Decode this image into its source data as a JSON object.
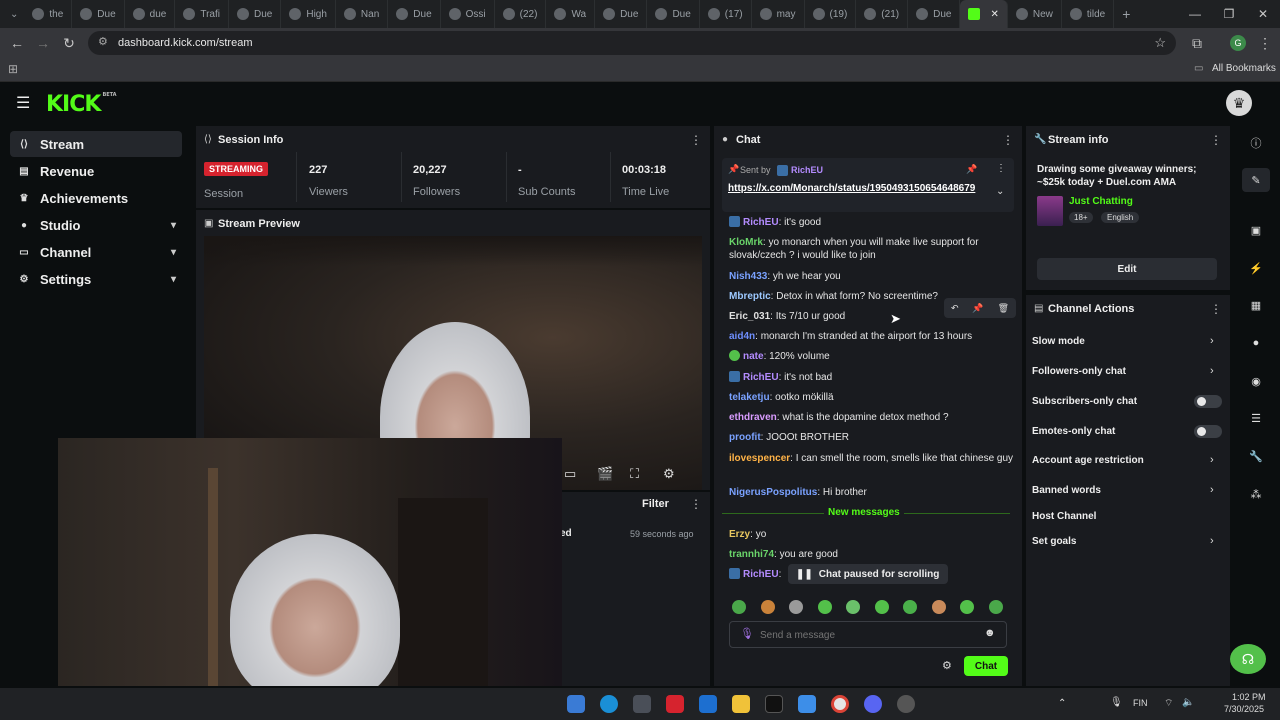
{
  "browser": {
    "tabs": [
      "the",
      "Due",
      "due",
      "Trafi",
      "Due",
      "High",
      "Nan",
      "Due",
      "Ossi",
      "(22)",
      "Wa",
      "Due",
      "Due",
      "(17)",
      "may",
      "(19)",
      "(21)",
      "Due",
      "",
      "New",
      "tilde"
    ],
    "url": "dashboard.kick.com/stream",
    "bookmarks_label": "All Bookmarks",
    "profile_initial": "G"
  },
  "brand": {
    "logo": "KICK",
    "beta": "BETA"
  },
  "sidebar": {
    "items": [
      {
        "label": "Stream",
        "icon": "stream-icon",
        "expandable": false
      },
      {
        "label": "Revenue",
        "icon": "revenue-icon",
        "expandable": false
      },
      {
        "label": "Achievements",
        "icon": "trophy-icon",
        "expandable": false
      },
      {
        "label": "Studio",
        "icon": "studio-icon",
        "expandable": true
      },
      {
        "label": "Channel",
        "icon": "channel-icon",
        "expandable": true
      },
      {
        "label": "Settings",
        "icon": "gear-icon",
        "expandable": true
      }
    ]
  },
  "session": {
    "title": "Session Info",
    "status": "STREAMING",
    "status_label": "Session",
    "stats": [
      {
        "value": "227",
        "label": "Viewers"
      },
      {
        "value": "20,227",
        "label": "Followers"
      },
      {
        "value": "-",
        "label": "Sub Counts"
      },
      {
        "value": "00:03:18",
        "label": "Time Live"
      }
    ]
  },
  "preview": {
    "title": "Stream Preview"
  },
  "activity": {
    "filter_label": "Filter",
    "partial_label": "ed",
    "time": "59 seconds ago"
  },
  "chat": {
    "title": "Chat",
    "pinned": {
      "sent_by_label": "Sent by",
      "sender": "RichEU",
      "link": "https://x.com/Monarch/status/1950493150654648679"
    },
    "messages": [
      {
        "user": "RichEU",
        "text": "it's good",
        "color": "#b48cff",
        "badge": "blue"
      },
      {
        "user": "KloMrk",
        "text": "yo monarch when you will make live support for slovak/czech ? i would like to join",
        "color": "#6ad46a",
        "badge": ""
      },
      {
        "user": "Nish433",
        "text": "yh we hear you",
        "color": "#7aa2ff",
        "badge": ""
      },
      {
        "user": "Mbreptic",
        "text": "Detox in what form? No screentime?",
        "color": "#9dc9ff",
        "badge": ""
      },
      {
        "user": "Eric_031",
        "text": "Its 7/10 ur good",
        "color": "#e0e0e0",
        "badge": ""
      },
      {
        "user": "aid4n",
        "text": "monarch I'm stranded at the airport for 13 hours",
        "color": "#6f8fff",
        "badge": ""
      },
      {
        "user": "nate",
        "text": "120% volume",
        "color": "#b48cff",
        "badge": "green"
      },
      {
        "user": "RichEU",
        "text": "it's not bad",
        "color": "#b48cff",
        "badge": "blue"
      },
      {
        "user": "telaketju",
        "text": "ootko mökillä",
        "color": "#7aa2ff",
        "badge": ""
      },
      {
        "user": "ethdraven",
        "text": "what is the dopamine detox method ?",
        "color": "#d99cff",
        "badge": ""
      },
      {
        "user": "proofit",
        "text": "JOOOt BROTHER",
        "color": "#7aa2ff",
        "badge": ""
      },
      {
        "user": "ilovespencer",
        "text": "I can smell the room, smells like that chinese guy",
        "color": "#ffb347",
        "badge": ""
      },
      {
        "user": "NigerusPospolitus",
        "text": "Hi brother",
        "color": "#7aa2ff",
        "badge": ""
      }
    ],
    "new_messages_label": "New messages",
    "new_messages": [
      {
        "user": "Erzy",
        "text": "yo",
        "color": "#e8c760",
        "badge": ""
      },
      {
        "user": "trannhi74",
        "text": "you are good",
        "color": "#6ad46a",
        "badge": ""
      },
      {
        "user": "RichEU",
        "text": "",
        "color": "#b48cff",
        "badge": "blue"
      }
    ],
    "paused_label": "Chat paused for scrolling",
    "input_placeholder": "Send a message",
    "send_label": "Chat"
  },
  "stream_info": {
    "title": "Stream info",
    "stream_title": "Drawing some giveaway winners; ~$25k today + Duel.com AMA",
    "category": "Just Chatting",
    "tags": [
      "18+",
      "English"
    ],
    "edit_label": "Edit"
  },
  "channel_actions": {
    "title": "Channel Actions",
    "items": [
      {
        "label": "Slow mode",
        "control": "chevron"
      },
      {
        "label": "Followers-only chat",
        "control": "chevron"
      },
      {
        "label": "Subscribers-only chat",
        "control": "toggle"
      },
      {
        "label": "Emotes-only chat",
        "control": "toggle"
      },
      {
        "label": "Account age restriction",
        "control": "chevron"
      },
      {
        "label": "Banned words",
        "control": "chevron"
      },
      {
        "label": "Host Channel",
        "control": "none"
      },
      {
        "label": "Set goals",
        "control": "chevron"
      }
    ]
  },
  "taskbar": {
    "lang": "FIN",
    "time": "1:02 PM",
    "date": "7/30/2025"
  },
  "colors": {
    "accent": "#53fc18",
    "live": "#d6232e",
    "panel": "#191b1f",
    "bg": "#0b0e0f"
  }
}
